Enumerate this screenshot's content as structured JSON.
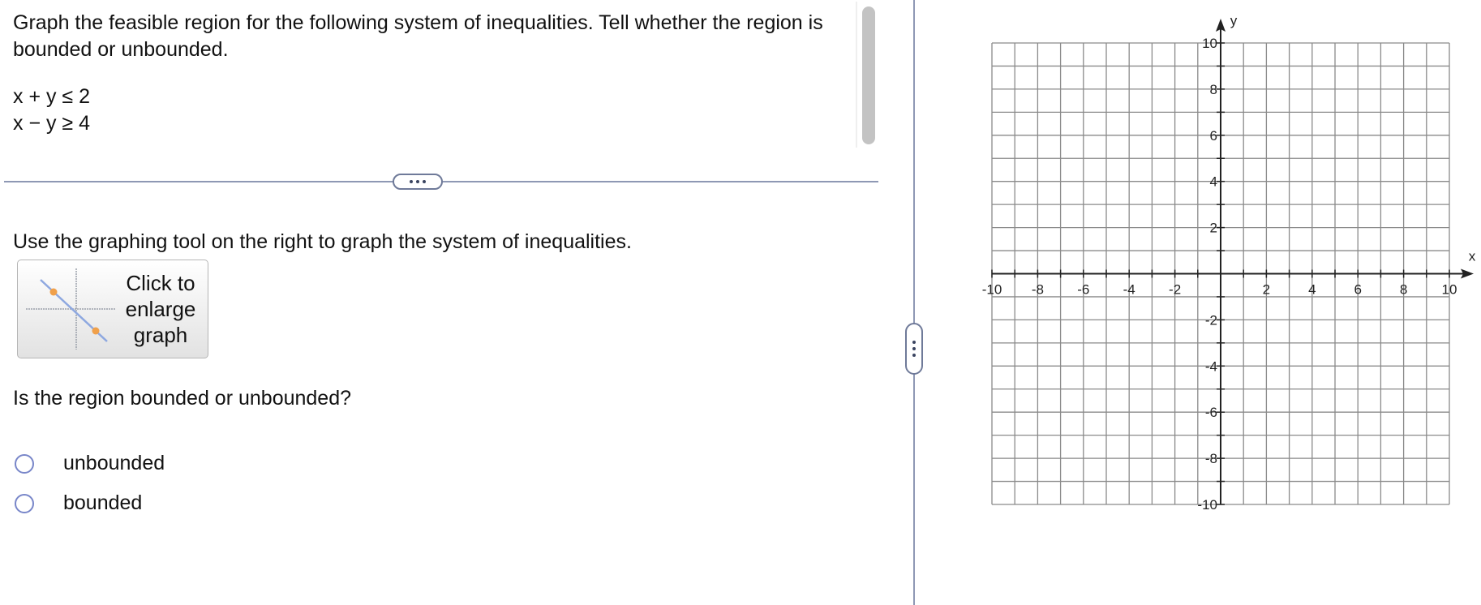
{
  "problem": {
    "prompt": "Graph the feasible region for the following system of inequalities. Tell whether the region is bounded or unbounded.",
    "inequalities": [
      "x + y ≤ 2",
      "x − y ≥ 4"
    ]
  },
  "instruction": "Use the graphing tool on the right to graph the system of inequalities.",
  "enlarge_button": {
    "label_lines": [
      "Click to",
      "enlarge",
      "graph"
    ]
  },
  "question": "Is the region bounded or unbounded?",
  "choices": [
    {
      "label": "unbounded",
      "selected": false
    },
    {
      "label": "bounded",
      "selected": false
    }
  ],
  "graph": {
    "x_axis_label": "x",
    "y_axis_label": "y",
    "x_range": [
      -10,
      10
    ],
    "y_range": [
      -10,
      10
    ],
    "grid_step": 1,
    "x_tick_labels": [
      "-10",
      "-8",
      "-6",
      "-4",
      "-2",
      "2",
      "4",
      "6",
      "8",
      "10"
    ],
    "y_tick_labels": [
      "10",
      "8",
      "6",
      "4",
      "2",
      "-2",
      "-4",
      "-6",
      "-8",
      "-10"
    ]
  },
  "colors": {
    "accent": "#7886c9",
    "divider": "#8e98b4",
    "grid": "#8a8a8a",
    "axis": "#222222"
  }
}
